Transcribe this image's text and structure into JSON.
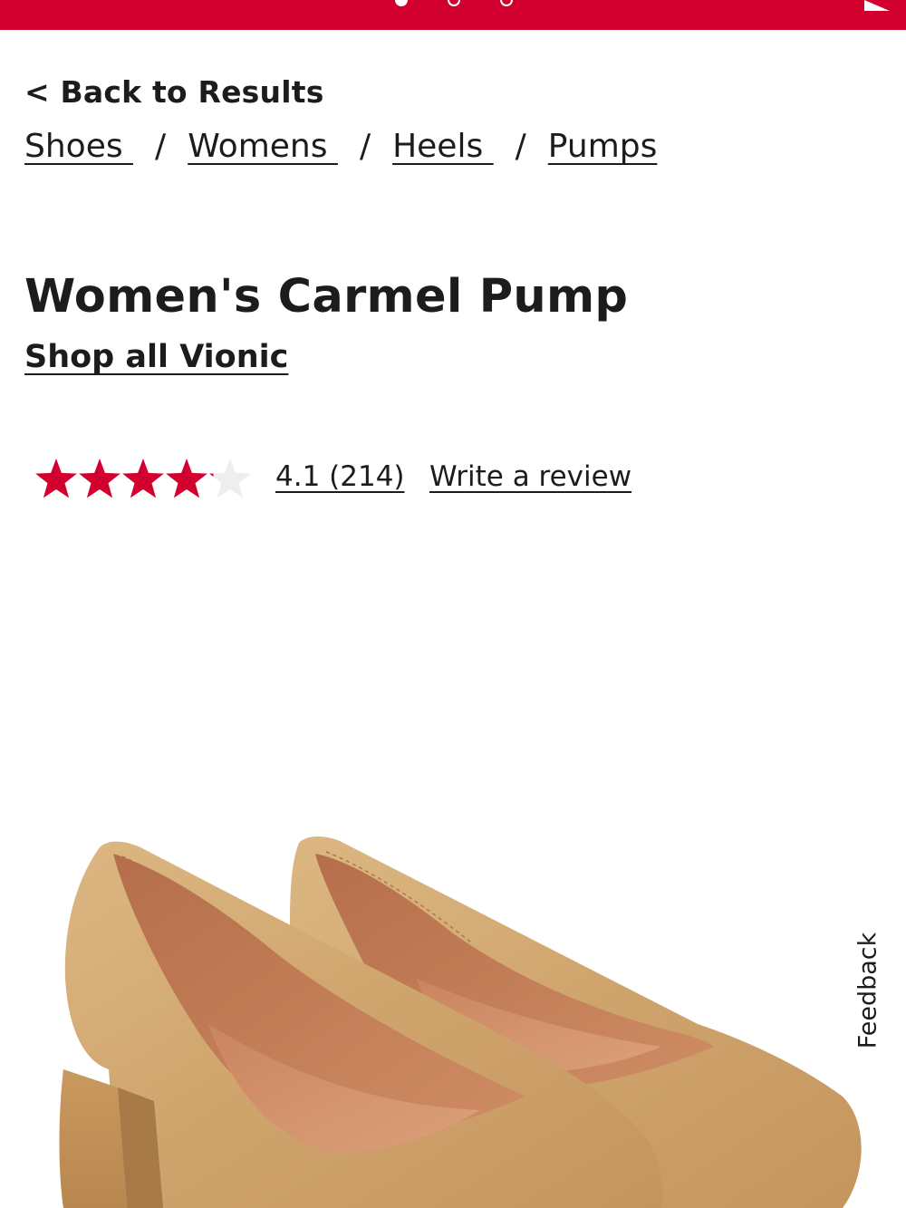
{
  "promo": {
    "slide_count": 3,
    "active_slide": 1,
    "next_icon": "play-arrow-icon",
    "color": "#d2002e"
  },
  "nav": {
    "back_label": "< Back to Results"
  },
  "breadcrumb": {
    "items": [
      "Shoes ",
      "Womens ",
      "Heels ",
      "Pumps"
    ],
    "separator": "/"
  },
  "product": {
    "title": "Women's Carmel Pump",
    "brand_link": "Shop all Vionic",
    "rating": {
      "value": 4.1,
      "max": 5,
      "star_color": "#d2002e",
      "empty_star_color": "#eeeeee",
      "summary_label": "4.1 (214)",
      "write_review_label": "Write a review"
    },
    "image_icon": "tan-leather-pumps-image"
  },
  "feedback": {
    "label": "Feedback"
  }
}
